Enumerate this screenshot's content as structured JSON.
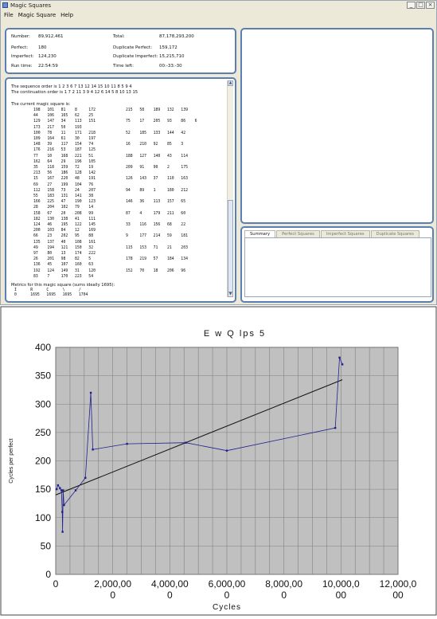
{
  "window": {
    "title": "Magic Squares",
    "buttons": [
      "_",
      "□",
      "×"
    ]
  },
  "menu": [
    "File",
    "Magic Square",
    "Help"
  ],
  "stats": {
    "number_label": "Number:",
    "number_value": "89,912,461",
    "perfect_label": "Perfect:",
    "perfect_value": "180",
    "imperfect_label": "Imperfect:",
    "imperfect_value": "124,230",
    "runtime_label": "Run time:",
    "runtime_value": "22:54:59",
    "total_label": "Total:",
    "total_value": "87,178,293,200",
    "dupperfect_label": "Duplicate Perfect:",
    "dupperfect_value": "159,172",
    "dupimperfect_label": "Duplicate Imperfect:",
    "dupimperfect_value": "15,215,710",
    "timeleft_label": "Time left:",
    "timeleft_value": "00:-33:-30"
  },
  "text": {
    "seq": "The sequence order is 1 2 3 6 7 13 12 14 15 10 11 8 5 9 4",
    "cont": "The continuation order is 1 7 2 11 3 9 4 12 6 14 5 8 10 13 15",
    "current": "The current magic square is:",
    "left_rows": [
      "198   101   81    8     172",
      "44    106   165   62    25",
      "129   147   34    113   151",
      "173   217   50    193",
      "100   78    11    171   218",
      "109   164   61    30    197",
      "148   39    117   154   74",
      "176   216   53    187   125",
      "77    10    168   221   51",
      "162   64    29    196   105",
      "35    118   159   72    19",
      "213   56    186   128   142",
      "15    167   220   48    191",
      "69    27    199   104   76",
      "112   158   73    24    207",
      "55    183   131   141   38",
      "166   225   47    190   123",
      "28    204   102   79    14",
      "158   67    20    208   99",
      "182   130   138   41    111",
      "124   46    195   122   145",
      "200   103   84    12    169",
      "66    23    202   95    88",
      "135   137   40    108   161",
      "49    194   121   150   32",
      "97    80    13    174   222",
      "26    201   98    82    5",
      "136   45    107   160   63",
      "192   124   149   31    120",
      "83    7     170   223   54"
    ],
    "right_rows": [
      "215   58    189   132   139",
      "",
      "75    17    205   93    86    6",
      "",
      "52    185   133   144   42",
      "",
      "16    210   92    85    3",
      "",
      "188   127   140   43    114",
      "",
      "209   91    90    2     175",
      "",
      "126   143   37    110   163",
      "",
      "94    89    1     180   212",
      "",
      "146   36    113   157   65",
      "",
      "87    4     179   211   60",
      "",
      "33    116   156   68    22",
      "",
      "9     177   214   59    181",
      "",
      "115   153   71    21    203",
      "",
      "178   219   57    184   134",
      "",
      "152   70    18    206   96",
      ""
    ],
    "metrics": "Metrics for this magic square (sums ideally 1695):",
    "metrics_head": "I      R      C      \\      /",
    "metrics_vals": "0      1695   1695   1695   1704"
  },
  "tabs": [
    "Summary",
    "Perfect Squares",
    "Imperfect Squares",
    "Duplicate Squares"
  ],
  "chart_data": {
    "type": "scatter",
    "title": "E w Q lps 5",
    "xlabel": "Cycles",
    "ylabel": "Cycles per perfect",
    "xlim": [
      0,
      12000
    ],
    "ylim": [
      0,
      400
    ],
    "x_ticks": [
      0,
      2000,
      4000,
      6000,
      8000,
      10000,
      12000
    ],
    "x_tick_labels": [
      "0",
      "2,000,00\n0",
      "4,000,00\n0",
      "6,000,00\n0",
      "8,000,00\n0",
      "10,000,0\n00",
      "12,000,0\n00"
    ],
    "y_ticks": [
      0,
      50,
      100,
      150,
      200,
      250,
      300,
      350,
      400
    ],
    "series": [
      {
        "values_x": [
          30,
          80,
          150,
          200,
          230,
          240,
          260,
          290,
          700,
          1040,
          1230,
          1300,
          2500,
          4560,
          6000,
          9800,
          9950,
          10050
        ],
        "values_y": [
          150,
          157,
          152,
          148,
          110,
          75,
          148,
          122,
          148,
          170,
          320,
          220,
          230,
          232,
          218,
          258,
          382,
          370
        ]
      }
    ],
    "trendline": {
      "x": [
        0,
        10050
      ],
      "y": [
        140,
        343
      ]
    },
    "colors": {
      "series": "#1f1f8f",
      "trend": "#111111",
      "plot_bg": "#c0c0c0",
      "grid": "#808080"
    }
  }
}
